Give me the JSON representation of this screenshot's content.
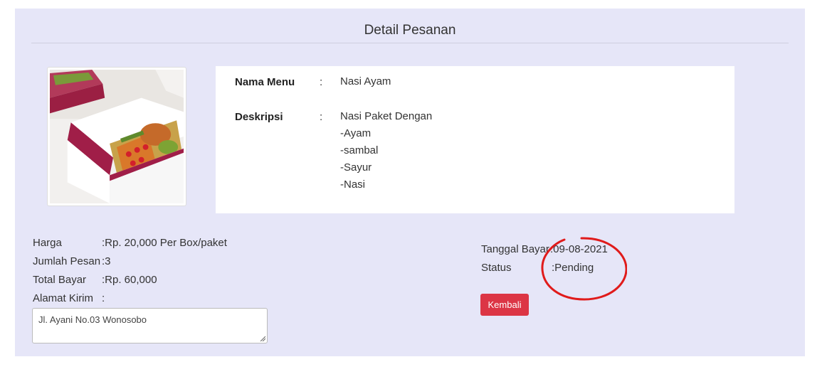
{
  "page": {
    "title": "Detail Pesanan"
  },
  "menu": {
    "name_label": "Nama Menu",
    "separator": ":",
    "name_value": "Nasi Ayam",
    "desc_label": "Deskripsi",
    "desc_lines": [
      "Nasi Paket Dengan",
      "-Ayam",
      "-sambal",
      "-Sayur",
      "-Nasi"
    ]
  },
  "order": {
    "harga_label": "Harga",
    "harga_value": ":Rp. 20,000 Per Box/paket",
    "jumlah_label": "Jumlah Pesan",
    "jumlah_value": ":3",
    "total_label": "Total Bayar",
    "total_value": ":Rp. 60,000",
    "alamat_label": "Alamat Kirim",
    "alamat_colon": ":",
    "alamat_value": "Jl. Ayani No.03 Wonosobo"
  },
  "payment": {
    "tanggal_label": "Tanggal Bayar",
    "tanggal_value": ":09-08-2021",
    "status_label": "Status",
    "status_value": ":Pending"
  },
  "actions": {
    "back_label": "Kembali"
  },
  "colors": {
    "card_bg": "#e6e6f8",
    "danger": "#dc3545",
    "annotation": "#e01b1b"
  },
  "icons": {
    "product_image": "food-box-photo"
  }
}
